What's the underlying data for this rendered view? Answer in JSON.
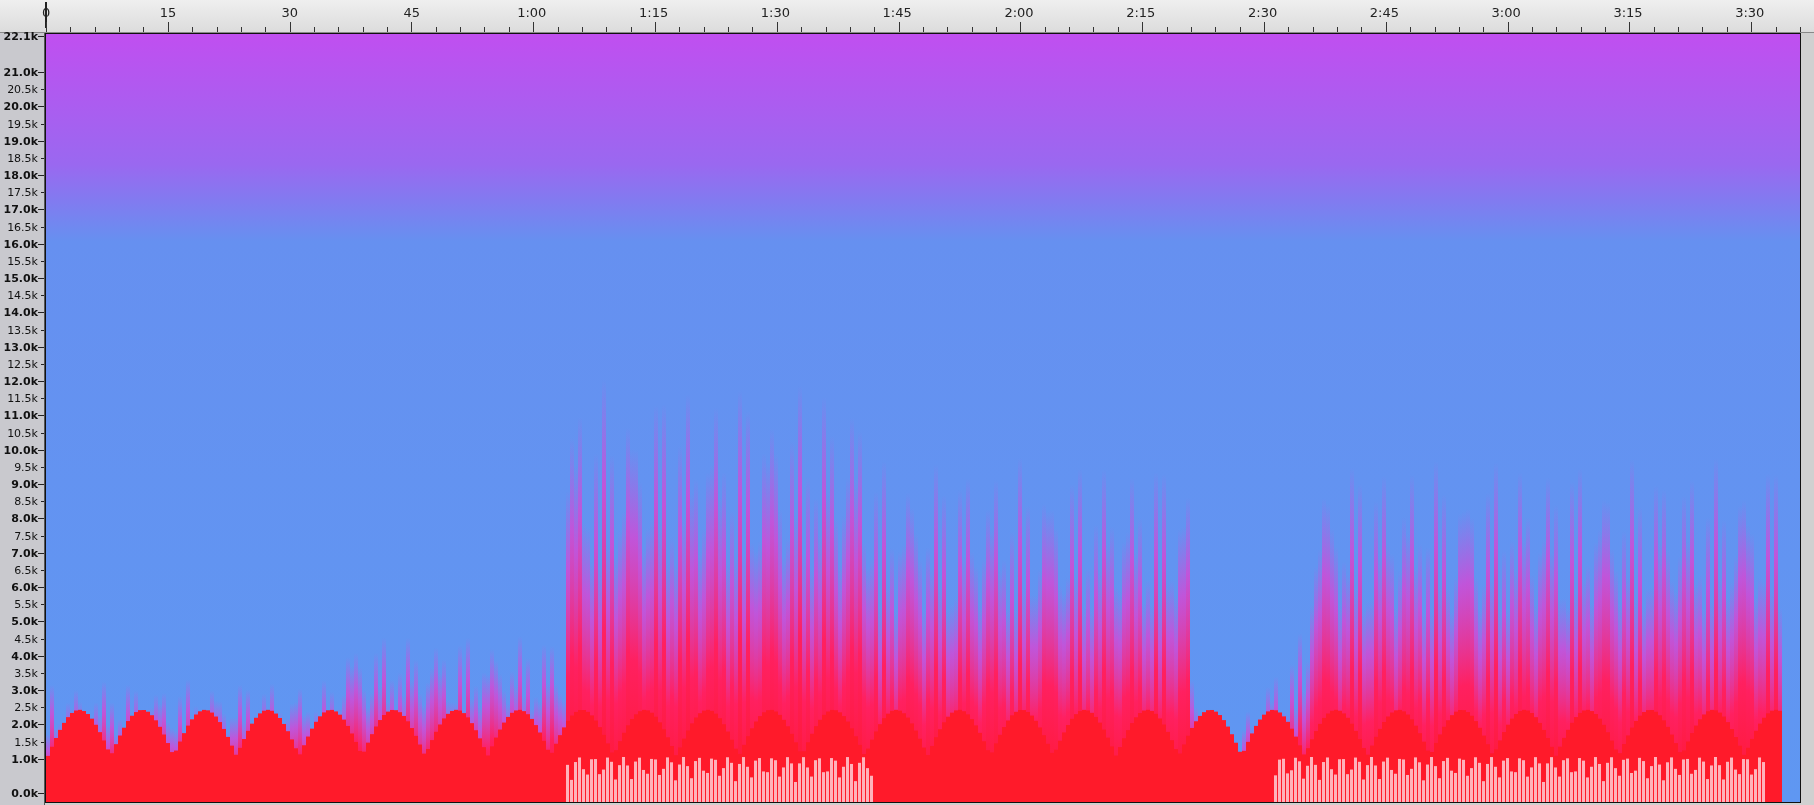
{
  "time_ruler": {
    "labels": [
      "0",
      "15",
      "30",
      "45",
      "1:00",
      "1:15",
      "1:30",
      "1:45",
      "2:00",
      "2:15",
      "2:30",
      "2:45",
      "3:00",
      "3:15",
      "3:30"
    ]
  },
  "frequency_axis": {
    "labels": [
      {
        "label": "22.1k",
        "major": true
      },
      {
        "label": "21.0k",
        "major": true
      },
      {
        "label": "20.5k",
        "major": false
      },
      {
        "label": "20.0k",
        "major": true
      },
      {
        "label": "19.5k",
        "major": false
      },
      {
        "label": "19.0k",
        "major": true
      },
      {
        "label": "18.5k",
        "major": false
      },
      {
        "label": "18.0k",
        "major": true
      },
      {
        "label": "17.5k",
        "major": false
      },
      {
        "label": "17.0k",
        "major": true
      },
      {
        "label": "16.5k",
        "major": false
      },
      {
        "label": "16.0k",
        "major": true
      },
      {
        "label": "15.5k",
        "major": false
      },
      {
        "label": "15.0k",
        "major": true
      },
      {
        "label": "14.5k",
        "major": false
      },
      {
        "label": "14.0k",
        "major": true
      },
      {
        "label": "13.5k",
        "major": false
      },
      {
        "label": "13.0k",
        "major": true
      },
      {
        "label": "12.5k",
        "major": false
      },
      {
        "label": "12.0k",
        "major": true
      },
      {
        "label": "11.5k",
        "major": false
      },
      {
        "label": "11.0k",
        "major": true
      },
      {
        "label": "10.5k",
        "major": false
      },
      {
        "label": "10.0k",
        "major": true
      },
      {
        "label": "9.5k",
        "major": false
      },
      {
        "label": "9.0k",
        "major": true
      },
      {
        "label": "8.5k",
        "major": false
      },
      {
        "label": "8.0k",
        "major": true
      },
      {
        "label": "7.5k",
        "major": false
      },
      {
        "label": "7.0k",
        "major": true
      },
      {
        "label": "6.5k",
        "major": false
      },
      {
        "label": "6.0k",
        "major": true
      },
      {
        "label": "5.5k",
        "major": false
      },
      {
        "label": "5.0k",
        "major": true
      },
      {
        "label": "4.5k",
        "major": false
      },
      {
        "label": "4.0k",
        "major": true
      },
      {
        "label": "3.5k",
        "major": false
      },
      {
        "label": "3.0k",
        "major": true
      },
      {
        "label": "2.5k",
        "major": false
      },
      {
        "label": "2.0k",
        "major": true
      },
      {
        "label": "1.5k",
        "major": false
      },
      {
        "label": "1.0k",
        "major": true
      },
      {
        "label": "0.0k",
        "major": true
      }
    ]
  }
}
